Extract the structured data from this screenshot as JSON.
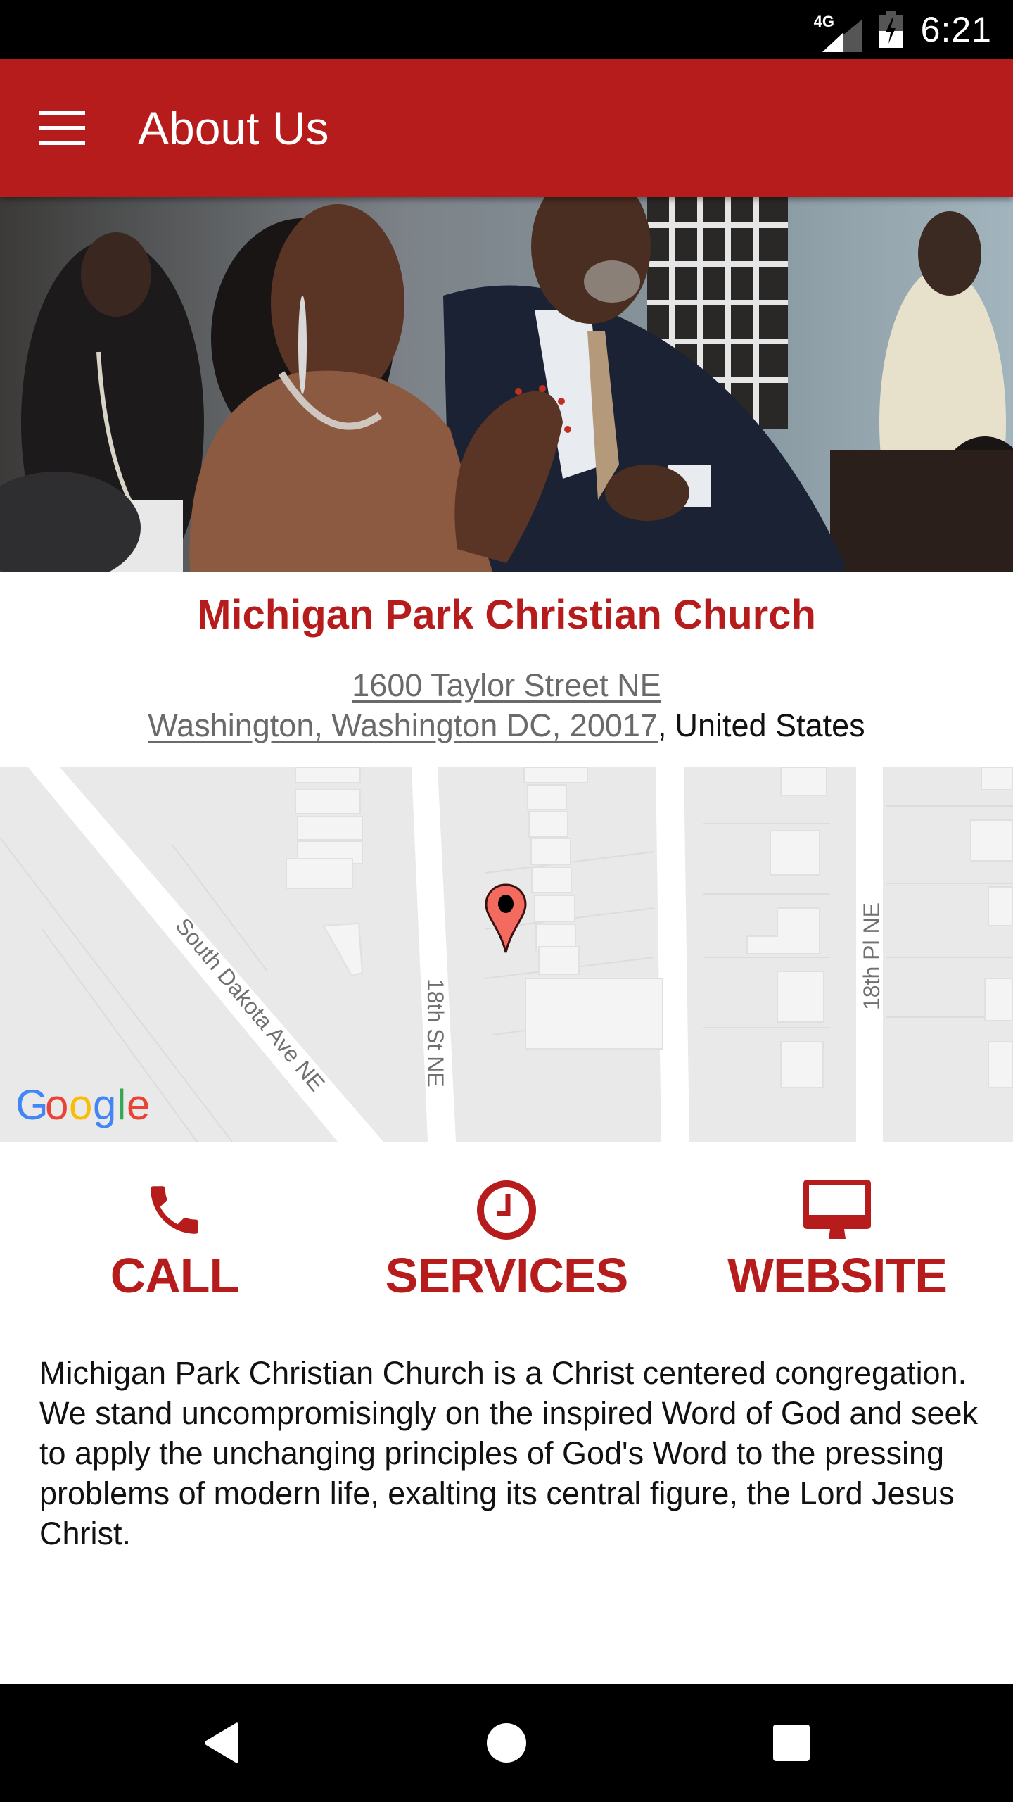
{
  "status_bar": {
    "network_label": "4G",
    "time": "6:21",
    "icons": [
      "signal-icon",
      "battery-charging-icon"
    ]
  },
  "toolbar": {
    "title": "About Us",
    "menu_icon": "hamburger-menu-icon"
  },
  "hero": {
    "description": "church congregation worship photo"
  },
  "church": {
    "name": "Michigan Park Christian Church",
    "address_line1": "1600 Taylor Street NE",
    "address_line2": "Washington, Washington DC, 20017",
    "address_separator": ",",
    "country": "United States"
  },
  "map": {
    "streets": [
      "South Dakota Ave NE",
      "18th St NE",
      "18th Pl NE"
    ],
    "attribution": "Google",
    "marker_icon": "map-pin-icon"
  },
  "actions": [
    {
      "label": "CALL",
      "icon": "phone-icon"
    },
    {
      "label": "SERVICES",
      "icon": "clock-icon"
    },
    {
      "label": "WEBSITE",
      "icon": "monitor-icon"
    }
  ],
  "description": "Michigan Park Christian Church is a Christ centered congregation. We stand uncompromisingly on the inspired Word of God and seek to apply the unchanging principles of God's Word to the pressing problems of modern life, exalting its central figure, the Lord Jesus Christ.",
  "colors": {
    "primary": "#b71c1c",
    "marker": "#f36b5e",
    "map_bg": "#e9e9e9"
  },
  "nav_bar": {
    "buttons": [
      "back-icon",
      "home-icon",
      "recents-icon"
    ]
  }
}
